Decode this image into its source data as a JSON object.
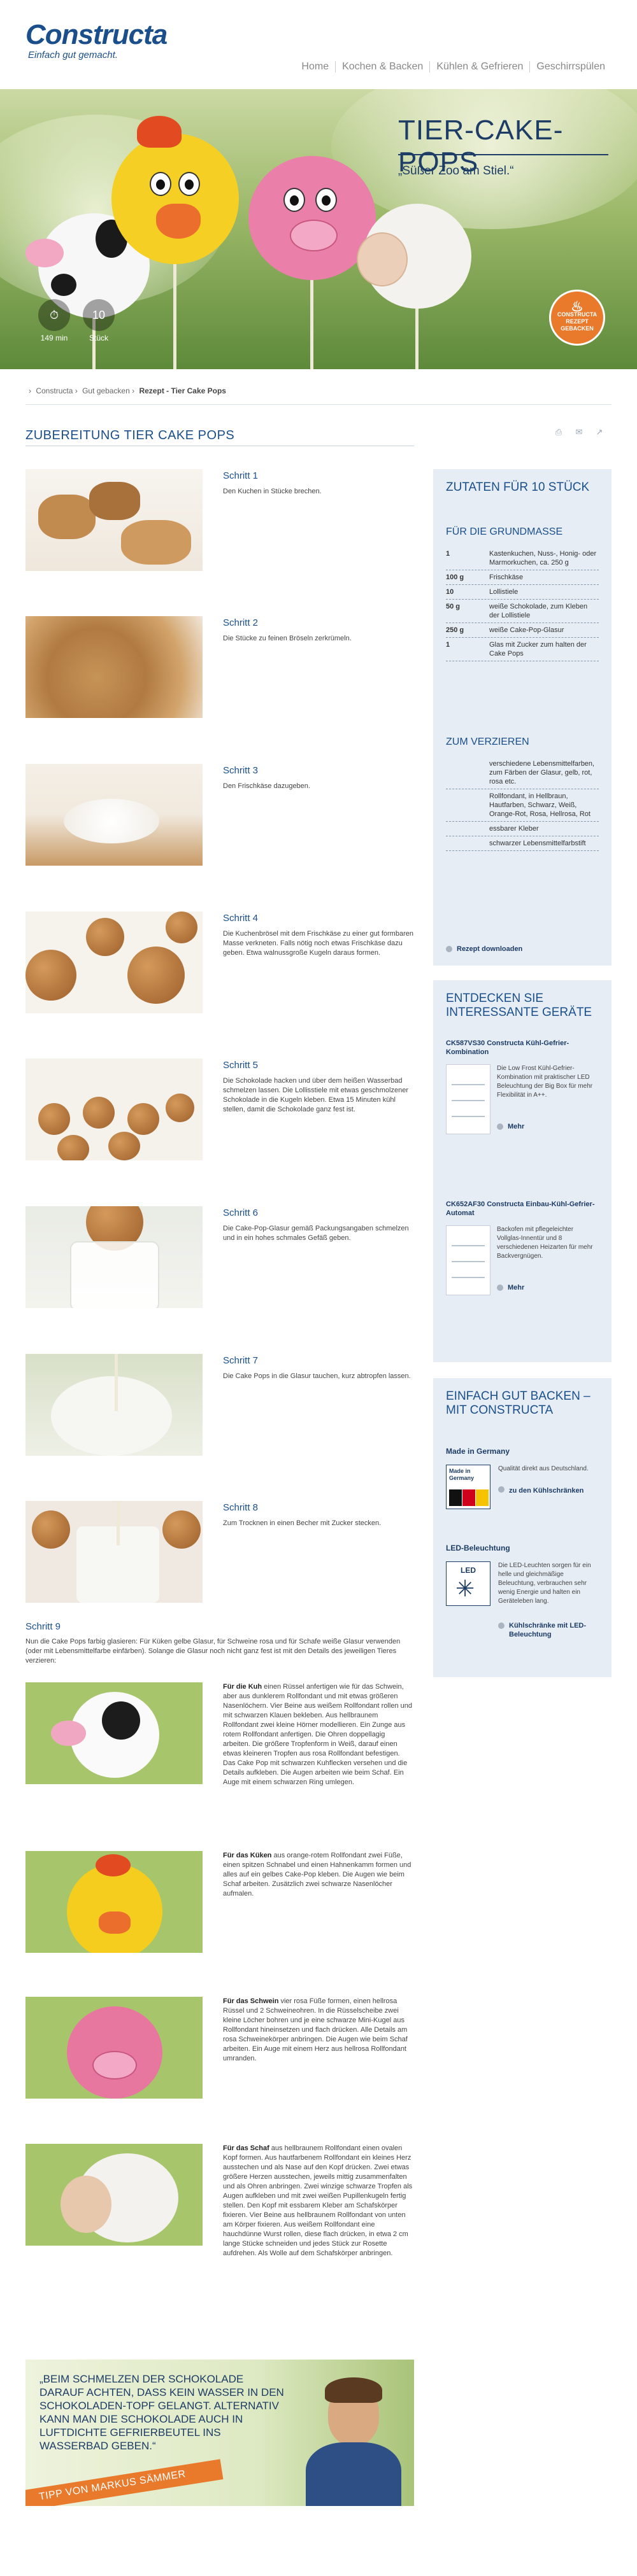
{
  "brand": {
    "logo": "Constructa",
    "tagline": "Einfach gut gemacht."
  },
  "nav": [
    "Home",
    "Kochen & Backen",
    "Kühlen & Gefrieren",
    "Geschirrspülen"
  ],
  "hero": {
    "title": "TIER-CAKE-POPS",
    "subtitle": "„Süßer Zoo am Stiel.“",
    "stats": [
      {
        "value": "⏱",
        "label": "149 min"
      },
      {
        "value": "10",
        "label": "Stück"
      }
    ],
    "badge_text": "CONSTRUCTA REZEPT GEBACKEN"
  },
  "breadcrumb": [
    "Constructa",
    "Gut gebacken",
    "Rezept - Tier Cake Pops"
  ],
  "main": {
    "title": "ZUBEREITUNG TIER CAKE POPS",
    "share_icons": [
      "print-icon",
      "mail-icon",
      "share-icon"
    ]
  },
  "steps": [
    {
      "title": "Schritt 1",
      "text": "Den Kuchen in Stücke brechen."
    },
    {
      "title": "Schritt 2",
      "text": "Die Stücke zu feinen Bröseln zerkrümeln."
    },
    {
      "title": "Schritt 3",
      "text": "Den Frischkäse dazugeben."
    },
    {
      "title": "Schritt 4",
      "text": "Die Kuchenbrösel mit dem Frischkäse zu einer gut formbaren Masse verkneten. Falls nötig noch etwas Frischkäse dazu geben. Etwa walnussgroße Kugeln daraus formen."
    },
    {
      "title": "Schritt 5",
      "text": "Die Schokolade hacken und über dem heißen Wasserbad schmelzen lassen. Die Lollisstiele mit etwas geschmolzener Schokolade in die Kugeln kleben. Etwa 15 Minuten kühl stellen, damit die Schokolade ganz fest ist."
    },
    {
      "title": "Schritt 6",
      "text": "Die Cake-Pop-Glasur gemäß Packungsangaben schmelzen und in ein hohes schmales Gefäß geben."
    },
    {
      "title": "Schritt 7",
      "text": "Die Cake Pops in die Glasur tauchen, kurz abtropfen lassen."
    },
    {
      "title": "Schritt 8",
      "text": "Zum Trocknen in einen Becher mit Zucker stecken."
    }
  ],
  "step9": {
    "title": "Schritt 9",
    "intro": "Nun die Cake Pops farbig glasieren: Für Küken gelbe Glasur, für Schweine rosa und für Schafe weiße Glasur verwenden (oder mit Lebensmittelfarbe einfärben). Solange die Glasur noch nicht ganz fest ist mit den Details des jeweiligen Tieres verzieren:",
    "animals": [
      {
        "name": "Für die Kuh",
        "text": " einen Rüssel anfertigen wie für das Schwein, aber aus dunklerem Rollfondant und mit etwas größeren Nasenlöchern. Vier Beine aus weißem Rollfondant rollen und mit schwarzen Klauen bekleben. Aus hellbraunem Rollfondant zwei kleine Hörner modellieren. Ein Zunge aus rotem Rollfondant anfertigen. Die Ohren doppellagig arbeiten. Die größere Tropfenform in Weiß, darauf einen etwas kleineren Tropfen aus rosa Rollfondant befestigen. Das Cake Pop mit schwarzen Kuhflecken versehen und die Details aufkleben. Die Augen arbeiten wie beim Schaf. Ein Auge mit einem schwarzen Ring umlegen."
      },
      {
        "name": "Für das Küken",
        "text": " aus orange-rotem Rollfondant zwei Füße, einen spitzen Schnabel und einen Hahnenkamm formen und alles auf ein gelbes Cake-Pop kleben. Die Augen wie beim Schaf arbeiten. Zusätzlich zwei schwarze Nasenlöcher aufmalen."
      },
      {
        "name": "Für das Schwein",
        "text": " vier rosa Füße formen, einen hellrosa Rüssel und 2 Schweineohren. In die Rüsselscheibe zwei kleine Löcher bohren und je eine schwarze Mini-Kugel aus Rollfondant hineinsetzen und flach drücken. Alle Details am rosa Schweinekörper anbringen. Die Augen wie beim Schaf arbeiten. Ein Auge mit einem Herz aus hellrosa Rollfondant umranden."
      },
      {
        "name": "Für das Schaf",
        "text": " aus hellbraunem Rollfondant einen ovalen Kopf formen. Aus hautfarbenem Rollfondant ein kleines Herz ausstechen und als Nase auf den Kopf drücken. Zwei etwas größere Herzen ausstechen, jeweils mittig zusammenfalten und als Ohren anbringen. Zwei winzige schwarze Tropfen als Augen aufkleben und mit zwei weißen Pupillenkugeln fertig stellen. Den Kopf mit essbarem Kleber am Schafskörper fixieren. Vier Beine aus hellbraunem Rollfondant von unten am Körper fixieren. Aus weißem Rollfondant eine hauchdünne Wurst rollen, diese flach drücken, in etwa 2 cm lange Stücke schneiden und jedes Stück zur Rosette aufdrehen. Als Wolle auf dem Schafskörper anbringen."
      }
    ]
  },
  "tip": {
    "quote": "„BEIM SCHMELZEN DER SCHOKOLADE DARAUF ACHTEN, DASS KEIN WASSER IN DEN SCHOKOLADEN-TOPF GELANGT. ALTERNATIV KANN MAN DIE SCHOKOLADE AUCH IN LUFTDICHTE GEFRIERBEUTEL INS WASSERBAD GEBEN.“",
    "band": "TIPP VON MARKUS SÄMMER"
  },
  "ingredients": {
    "title": "ZUTATEN FÜR 10 STÜCK",
    "group1": "FÜR DIE GRUNDMASSE",
    "items1": [
      {
        "amount": "1",
        "name": "Kastenkuchen, Nuss-, Honig- oder Marmorkuchen, ca. 250 g"
      },
      {
        "amount": "100 g",
        "name": "Frischkäse"
      },
      {
        "amount": "10",
        "name": "Lollistiele"
      },
      {
        "amount": "50 g",
        "name": "weiße Schokolade, zum Kleben der Lollistiele"
      },
      {
        "amount": "250 g",
        "name": "weiße Cake-Pop-Glasur"
      },
      {
        "amount": "1",
        "name": "Glas mit Zucker zum halten der Cake Pops"
      }
    ],
    "group2": "ZUM VERZIEREN",
    "items2": [
      {
        "amount": "",
        "name": "verschiedene Lebensmittelfarben, zum Färben der Glasur, gelb, rot, rosa etc."
      },
      {
        "amount": "",
        "name": "Rollfondant, in Hellbraun, Hautfarben, Schwarz, Weiß, Orange-Rot, Rosa, Hellrosa, Rot"
      },
      {
        "amount": "",
        "name": "essbarer Kleber"
      },
      {
        "amount": "",
        "name": "schwarzer Lebensmittelfarbstift"
      }
    ],
    "download": "Rezept downloaden"
  },
  "devices": {
    "title": "ENTDECKEN SIE INTERESSANTE GERÄTE",
    "items": [
      {
        "title": "CK587VS30 Constructa Kühl-Gefrier-Kombination",
        "text": "Die Low Frost Kühl-Gefrier-Kombination mit praktischer LED Beleuchtung der Big Box für mehr Flexibilität in A++.",
        "more": "Mehr"
      },
      {
        "title": "CK652AF30 Constructa Einbau-Kühl-Gefrier-Automat",
        "text": "Backofen mit pflegeleichter Vollglas-Innentür und 8 verschiedenen Heizarten für mehr Backvergnügen.",
        "more": "Mehr"
      }
    ]
  },
  "features": {
    "title": "EINFACH GUT BACKEN – MIT CONSTRUCTA",
    "items": [
      {
        "title": "Made in Germany",
        "badge": "Made in Germany",
        "text": "Qualität direkt aus Deutschland.",
        "link": "zu den Kühlschränken"
      },
      {
        "title": "LED-Beleuchtung",
        "badge": "LED",
        "text": "Die LED-Leuchten sorgen für ein helle und gleichmäßige Beleuchtung, verbrauchen sehr wenig Energie und halten ein Geräteleben lang.",
        "link": "Kühlschränke mit LED-Beleuchtung"
      }
    ]
  }
}
